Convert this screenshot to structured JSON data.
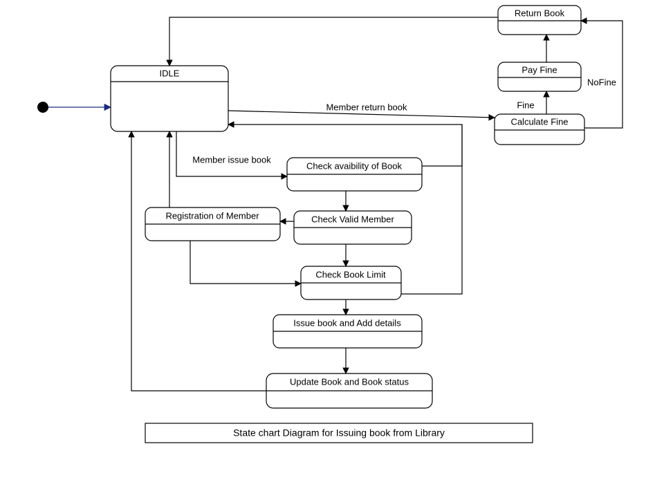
{
  "states": {
    "idle": {
      "label": "IDLE"
    },
    "check_avail": {
      "label": "Check avaibility of Book"
    },
    "check_member": {
      "label": "Check Valid Member"
    },
    "registration": {
      "label": "Registration of Member"
    },
    "check_limit": {
      "label": "Check Book Limit"
    },
    "issue_book": {
      "label": "Issue book and Add details"
    },
    "update_status": {
      "label": "Update Book and Book status"
    },
    "calc_fine": {
      "label": "Calculate Fine"
    },
    "pay_fine": {
      "label": "Pay Fine"
    },
    "return_book": {
      "label": "Return Book"
    }
  },
  "edge_labels": {
    "issue": "Member issue book",
    "return": "Member return book",
    "fine": "Fine",
    "nofine": "NoFine"
  },
  "caption": "State chart Diagram for Issuing book from Library"
}
